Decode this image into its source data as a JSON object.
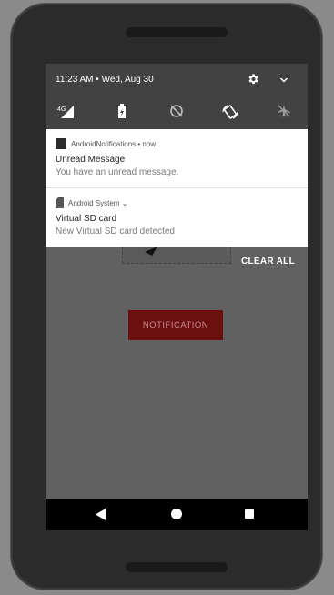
{
  "status": {
    "time_date": "11:23 AM • Wed, Aug 30"
  },
  "quick_settings": {
    "network_label": "4G",
    "icons": [
      "signal-icon",
      "battery-icon",
      "do-not-disturb-icon",
      "auto-rotate-icon",
      "airplane-mode-icon"
    ]
  },
  "notifications": [
    {
      "app": "AndroidNotifications • now",
      "title": "Unread Message",
      "text": "You have an unread message."
    },
    {
      "app": "Android System ⌄",
      "title": "Virtual SD card",
      "text": "New Virtual SD card detected"
    }
  ],
  "shade": {
    "clear_all": "CLEAR ALL"
  },
  "app": {
    "button_label": "NOTIFICATION"
  },
  "colors": {
    "screen_bg": "#616161",
    "header_bg": "#424242",
    "button_bg": "#6b0f0f"
  }
}
